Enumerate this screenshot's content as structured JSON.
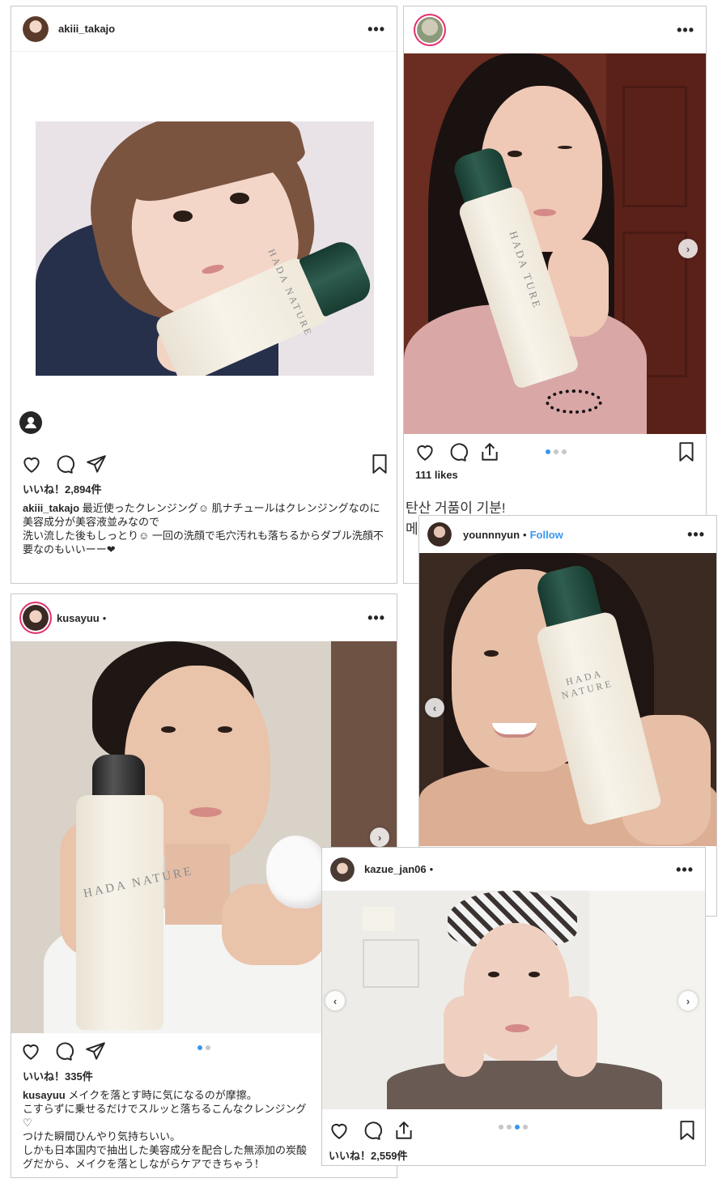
{
  "colors": {
    "link": "#3897f0",
    "story_ring": "#e1306c",
    "text": "#262626",
    "border": "#c8c8c8"
  },
  "posts": [
    {
      "username": "akiii_takajo",
      "likes": "いいね！2,894件",
      "caption_user": "akiii_takajo",
      "caption_text": " 最近使ったクレンジング☺︎ 肌ナチュールはクレンジングなのに\n美容成分が美容液並みなので\n洗い流した後もしっとり☺︎ 一回の洗顔で毛穴汚れも落ちるからダブル洗顔不要なのもいいーー❤",
      "bottle_brand": "HADA NATURE",
      "icons": [
        "heart-icon",
        "comment-icon",
        "share-icon",
        "bookmark-icon",
        "user-tag-icon"
      ]
    },
    {
      "username": "",
      "likes": "111 likes",
      "caption_line1": "탄산 거품이 기분!",
      "caption_line2": "메",
      "bottle_brand": "HADA TURE",
      "icons": [
        "heart-icon",
        "comment-icon",
        "share-icon",
        "bookmark-icon",
        "chevron-right-icon"
      ]
    },
    {
      "username": "younnnyun",
      "follow": "Follow",
      "bottle_brand": "HADA NATURE",
      "icons": [
        "chevron-left-icon"
      ]
    },
    {
      "username": "kusayuu",
      "likes": "いいね！335件",
      "caption_user": "kusayuu",
      "caption_text": " メイクを落とす時に気になるのが摩擦。\nこすらずに乗せるだけでスルッと落ちるこんなクレンジング\n♡\nつけた瞬間ひんやり気持ちいい。\nしかも日本国内で抽出した美容成分を配合した無添加の炭酸\nグだから、メイクを落としながらケアできちゃう！",
      "bottle_brand": "HADA NATURE",
      "icons": [
        "heart-icon",
        "comment-icon",
        "share-icon",
        "chevron-right-icon"
      ]
    },
    {
      "username": "kazue_jan06",
      "likes": "いいね！2,559件",
      "icons": [
        "heart-icon",
        "comment-icon",
        "share-icon",
        "bookmark-icon",
        "chevron-left-icon",
        "chevron-right-icon"
      ]
    }
  ],
  "header_separator": "•",
  "more_glyph": "•••",
  "chevron_left": "‹",
  "chevron_right": "›"
}
